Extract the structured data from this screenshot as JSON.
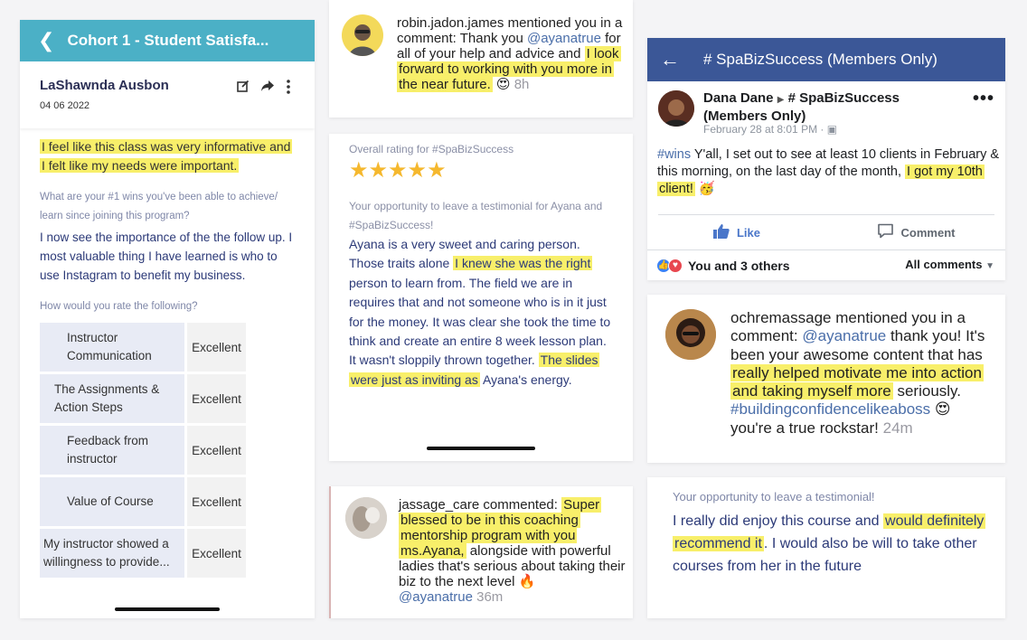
{
  "panel_a": {
    "header_title": "Cohort 1 - Student Satisfa...",
    "user_name": "LaShawnda Ausbon",
    "user_date": "04 06 2022",
    "quote": "I feel like this class was very informative and I felt like my needs were important.",
    "question_wins": "What are your #1 wins you've been able to achieve/ learn since joining this program?",
    "answer_wins": "I now see the importance of the the follow up. I most valuable thing I have learned is who to use Instagram to benefit my business.",
    "question_rate": "How would you rate the following?",
    "ratings": [
      {
        "criterion": "Instructor Communication",
        "value": "Excellent"
      },
      {
        "criterion": "The Assignments & Action Steps",
        "value": "Excellent"
      },
      {
        "criterion": "Feedback from instructor",
        "value": "Excellent"
      },
      {
        "criterion": "Value of Course",
        "value": "Excellent"
      },
      {
        "criterion": "My instructor showed a willingness to provide...",
        "value": "Excellent"
      }
    ]
  },
  "panel_b": {
    "notif1": {
      "user": "robin.jadon.james",
      "text_pre": "mentioned you in a comment: Thank you ",
      "mention": "@ayanatrue",
      "text_mid": " for all of your help and advice and ",
      "highlight": "I look forward to working with you more in the near future.",
      "emoji": "😍",
      "time": "8h"
    },
    "review": {
      "overall_label": "Overall rating for #SpaBizSuccess",
      "stars": 5,
      "opportunity_label": "Your opportunity to leave a testimonial for Ayana and #SpaBizSuccess!",
      "text_pre": "Ayana is a very sweet and caring person. Those traits alone ",
      "highlight1": "I knew she was the right",
      "text_mid": " person to learn from. The field we are in requires that and not someone who is in it just for the money. It was clear she took the time to think and create an entire 8 week lesson plan. It wasn't sloppily thrown together. ",
      "highlight2": "The slides were just as inviting as",
      "text_post": " Ayana's energy."
    },
    "notif2": {
      "user": "jassage_care",
      "text_pre": "commented: ",
      "highlight": "Super blessed to be in this coaching mentorship program with you ms.Ayana,",
      "text_post": " alongside with powerful ladies that's serious about taking their biz to the next level",
      "emoji": "🔥",
      "mention": "@ayanatrue",
      "time": "36m"
    }
  },
  "panel_c": {
    "group_title": "# SpaBizSuccess (Members Only)",
    "post": {
      "author": "Dana Dane",
      "group": "# SpaBizSuccess (Members Only)",
      "date": "February 28 at 8:01 PM",
      "hashtag": "#wins",
      "text": " Y'all, I set out to see at least 10 clients in February & this morning, on the last day of the month, ",
      "highlight": "I got my 10th client!",
      "emoji": "🥳"
    },
    "like_label": "Like",
    "comment_label": "Comment",
    "reactions_text": "You and 3 others",
    "all_comments_label": "All comments",
    "notif": {
      "user": "ochremassage",
      "text_pre": "mentioned you in a comment: ",
      "mention": "@ayanatrue",
      "text_mid": " thank you! It's been your awesome content that has ",
      "highlight": "really helped motivate me into action and taking myself more",
      "text_post": " seriously.",
      "hashtag": "#buildingconfidencelikeaboss",
      "emoji": "😍",
      "text_end": "you're a true rockstar!",
      "time": "24m"
    },
    "testimonial": {
      "label": "Your opportunity to leave a testimonial!",
      "text_pre": "I really did enjoy this course and ",
      "highlight": "would definitely recommend it",
      "text_post": ". I would also be will to take other courses from her in the future"
    }
  }
}
